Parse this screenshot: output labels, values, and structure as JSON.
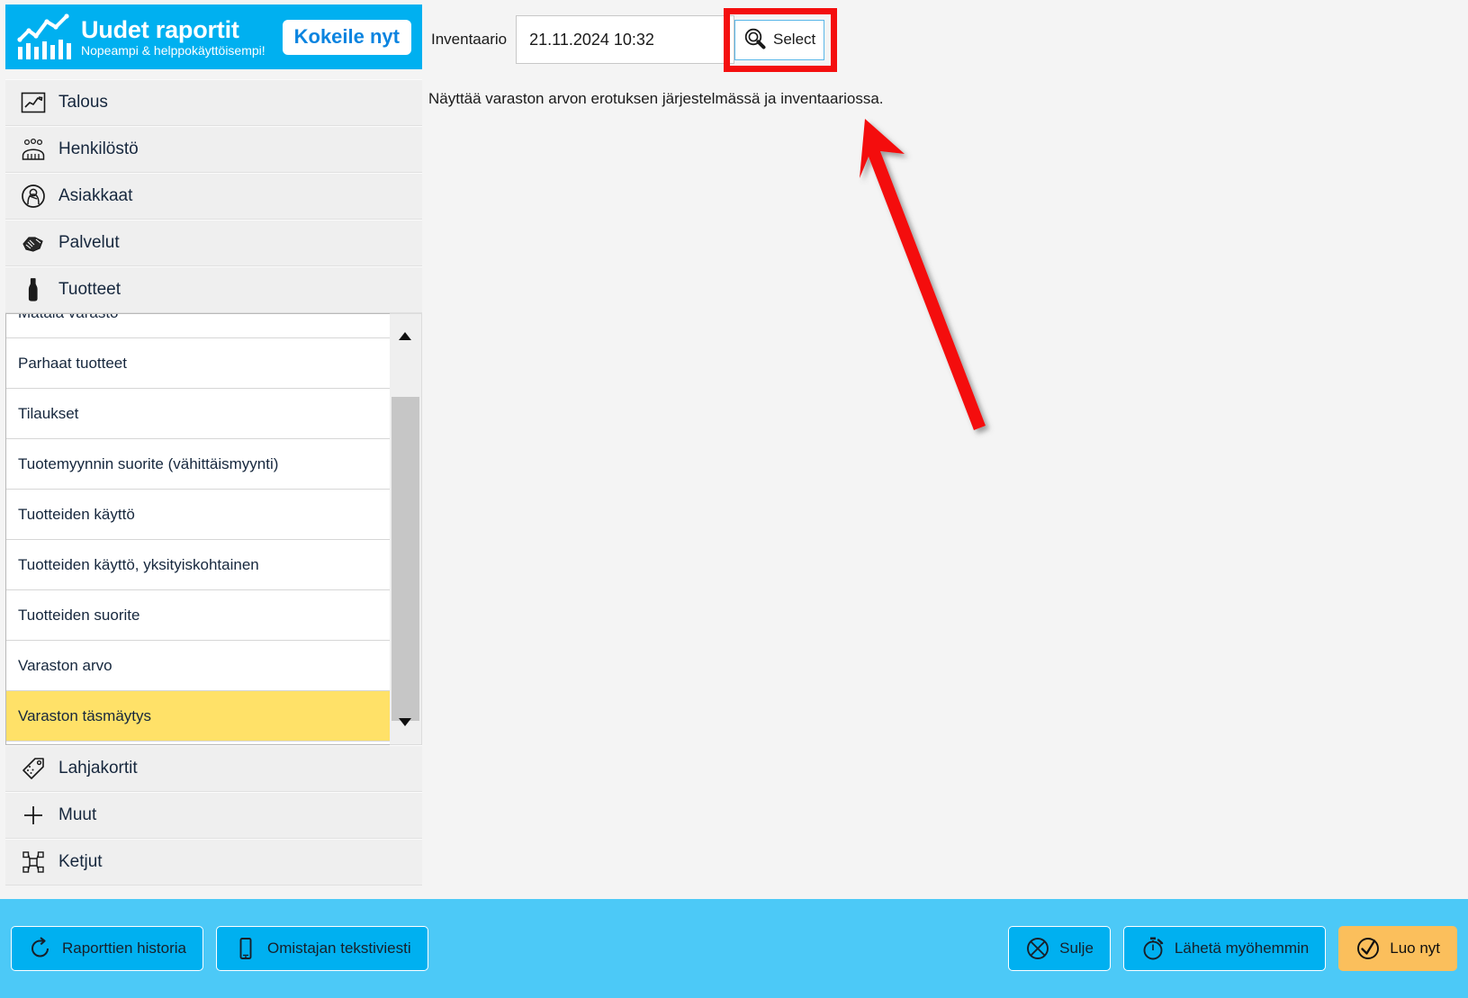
{
  "promo": {
    "icon": "bar-chart-line-icon",
    "title": "Uudet raportit",
    "subtitle": "Nopeampi & helppokäyttöisempi!",
    "cta_label": "Kokeile nyt",
    "bg_color": "#00b0f0",
    "cta_text_color": "#0a84e0"
  },
  "topbar": {
    "inventory_label": "Inventaario",
    "inventory_value": "21.11.2024 10:32",
    "inventory_placeholder": "",
    "select_label": "Select",
    "select_icon": "magnifier-icon",
    "highlight_color": "#f40f0f"
  },
  "sidebar": {
    "top_items": [
      {
        "label": "Talous",
        "icon": "line-chart-icon"
      },
      {
        "label": "Henkilöstö",
        "icon": "people-group-icon"
      },
      {
        "label": "Asiakkaat",
        "icon": "customer-head-icon"
      },
      {
        "label": "Palvelut",
        "icon": "handshake-icon"
      },
      {
        "label": "Tuotteet",
        "icon": "bottle-icon"
      }
    ],
    "bottom_items": [
      {
        "label": "Lahjakortit",
        "icon": "gift-tag-icon"
      },
      {
        "label": "Muut",
        "icon": "plus-icon"
      },
      {
        "label": "Ketjut",
        "icon": "network-nodes-icon"
      }
    ],
    "report_list": [
      {
        "label": "Matala varasto",
        "selected": false
      },
      {
        "label": "Parhaat tuotteet",
        "selected": false
      },
      {
        "label": "Tilaukset",
        "selected": false
      },
      {
        "label": "Tuotemyynnin suorite (vähittäismyynti)",
        "selected": false
      },
      {
        "label": "Tuotteiden käyttö",
        "selected": false
      },
      {
        "label": "Tuotteiden käyttö, yksityiskohtainen",
        "selected": false
      },
      {
        "label": "Tuotteiden suorite",
        "selected": false
      },
      {
        "label": "Varaston arvo",
        "selected": false
      },
      {
        "label": "Varaston täsmäytys",
        "selected": true
      }
    ],
    "scrollbar": {
      "up_arrow_icon": "triangle-up-icon",
      "down_arrow_icon": "triangle-down-icon"
    },
    "selected_highlight_color": "#ffe168"
  },
  "main": {
    "description": "Näyttää varaston arvon erotuksen järjestelmässä ja inventaariossa.",
    "annotation": {
      "type": "arrow",
      "color": "#f40f0f",
      "points_to": "select-button"
    }
  },
  "bottombar": {
    "bg_color": "#4cc9f7",
    "left_buttons": [
      {
        "label": "Raporttien historia",
        "icon": "history-undo-icon",
        "primary": false
      },
      {
        "label": "Omistajan tekstiviesti",
        "icon": "mobile-phone-icon",
        "primary": false
      }
    ],
    "right_buttons": [
      {
        "label": "Sulje",
        "icon": "close-circle-icon",
        "primary": false
      },
      {
        "label": "Lähetä myöhemmin",
        "icon": "stopwatch-icon",
        "primary": false
      },
      {
        "label": "Luo nyt",
        "icon": "check-circle-icon",
        "primary": true
      }
    ]
  }
}
